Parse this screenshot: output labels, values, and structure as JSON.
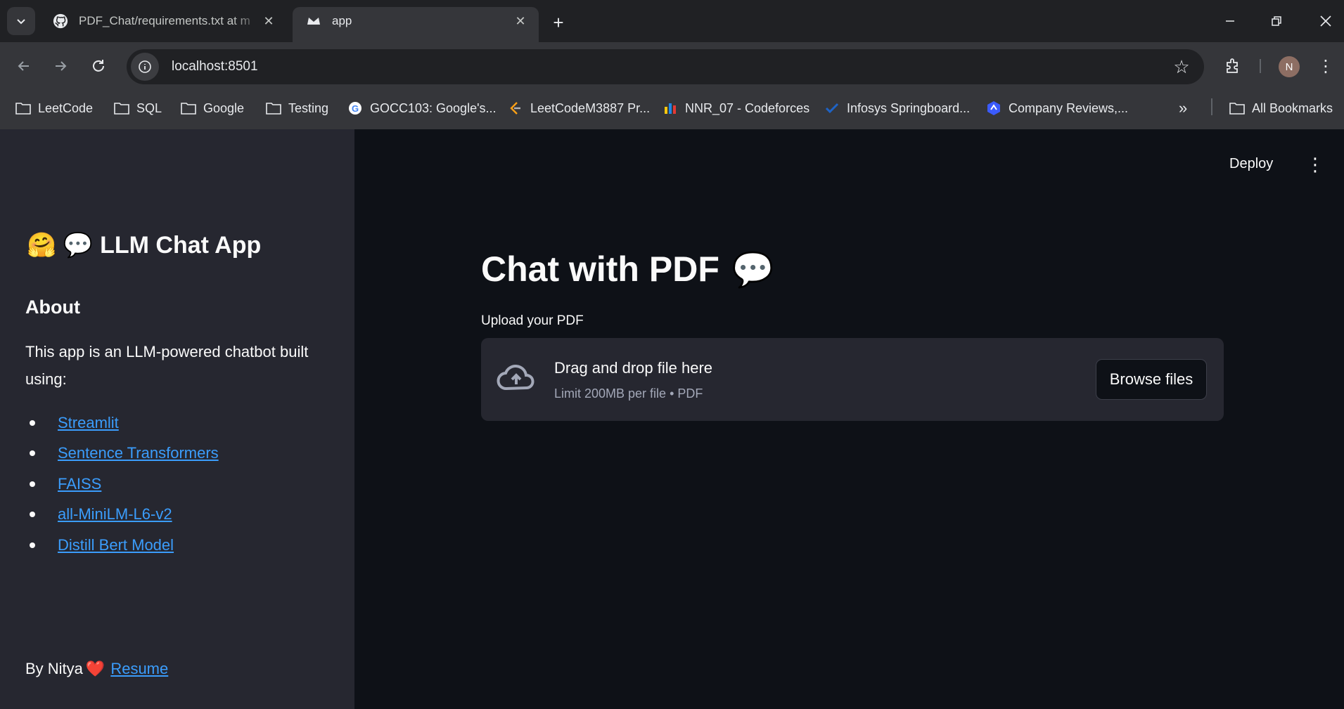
{
  "browser": {
    "tabs": [
      {
        "title": "PDF_Chat/requirements.txt at m",
        "icon": "github-icon"
      },
      {
        "title": "app",
        "icon": "streamlit-icon"
      }
    ],
    "url": "localhost:8501",
    "profile_initial": "N",
    "bookmarks": [
      {
        "label": "LeetCode",
        "icon": "folder-icon"
      },
      {
        "label": "SQL",
        "icon": "folder-icon"
      },
      {
        "label": "Google",
        "icon": "folder-icon"
      },
      {
        "label": "Testing",
        "icon": "folder-icon"
      },
      {
        "label": "GOCC103: Google's...",
        "icon": "google-icon"
      },
      {
        "label": "LeetCodeM3887 Pr...",
        "icon": "leetcode-icon"
      },
      {
        "label": "NNR_07 - Codeforces",
        "icon": "codeforces-icon"
      },
      {
        "label": "Infosys Springboard...",
        "icon": "infosys-icon"
      },
      {
        "label": "Company Reviews,...",
        "icon": "ambitionbox-icon"
      }
    ],
    "all_bookmarks_label": "All Bookmarks"
  },
  "sidebar": {
    "title_emoji": "🤗 💬",
    "title": "LLM Chat App",
    "about_heading": "About",
    "description": "This app is an LLM-powered chatbot built using:",
    "links": [
      "Streamlit",
      "Sentence Transformers",
      "FAISS",
      "all-MiniLM-L6-v2",
      "Distill Bert Model"
    ],
    "footer_text": "By Nitya",
    "footer_heart": "❤️",
    "footer_link": "Resume"
  },
  "main": {
    "deploy_label": "Deploy",
    "title": "Chat with PDF",
    "title_emoji": "💬",
    "upload_label": "Upload your PDF",
    "dropzone_text": "Drag and drop file here",
    "dropzone_hint": "Limit 200MB per file • PDF",
    "browse_label": "Browse files"
  },
  "colors": {
    "sidebar_bg": "#262730",
    "main_bg": "#0e1117",
    "link": "#3b9dfc",
    "text": "#fafafa"
  }
}
